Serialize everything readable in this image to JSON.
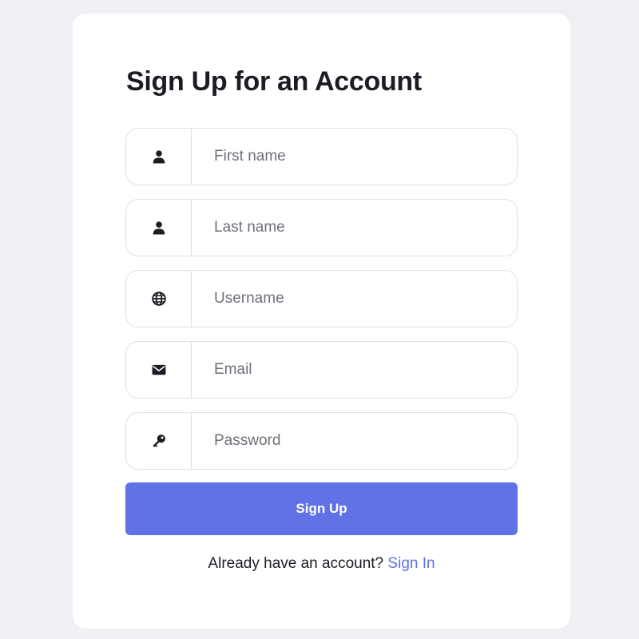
{
  "form": {
    "title": "Sign Up for an Account",
    "fields": [
      {
        "placeholder": "First name",
        "icon": "user-icon"
      },
      {
        "placeholder": "Last name",
        "icon": "user-icon"
      },
      {
        "placeholder": "Username",
        "icon": "globe-icon"
      },
      {
        "placeholder": "Email",
        "icon": "envelope-icon"
      },
      {
        "placeholder": "Password",
        "icon": "key-icon"
      }
    ],
    "submit_label": "Sign Up",
    "footer_text": "Already have an account?",
    "footer_link": "Sign In"
  },
  "colors": {
    "accent": "#5f72e6",
    "background": "#eef0f4",
    "card": "#ffffff",
    "border": "#dfe1e6",
    "text": "#1b1d24"
  }
}
